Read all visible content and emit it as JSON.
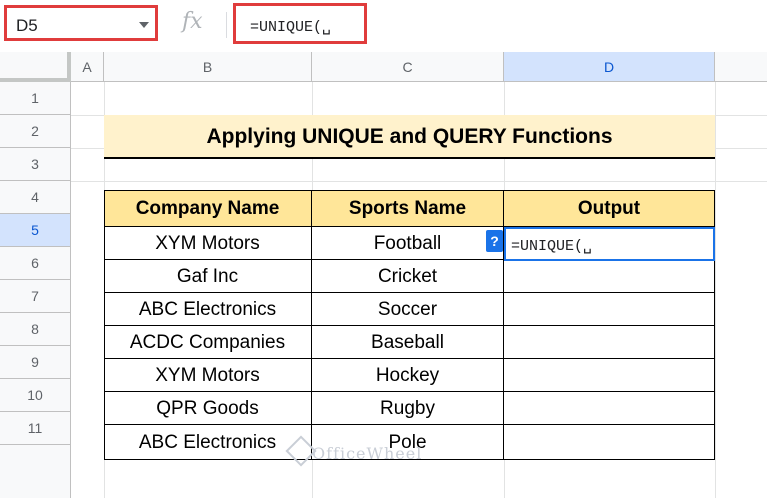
{
  "formula_bar": {
    "name_box": "D5",
    "fx": "fx",
    "formula": "=UNIQUE(␣"
  },
  "columns": [
    "A",
    "B",
    "C",
    "D"
  ],
  "rows": [
    "1",
    "2",
    "3",
    "4",
    "5",
    "6",
    "7",
    "8",
    "9",
    "10",
    "11"
  ],
  "active": {
    "column": "D",
    "row": "5"
  },
  "title": "Applying UNIQUE and QUERY Functions",
  "table": {
    "headers": [
      "Company Name",
      "Sports Name",
      "Output"
    ],
    "rows": [
      [
        "XYM Motors",
        "Football"
      ],
      [
        "Gaf Inc",
        "Cricket"
      ],
      [
        "ABC Electronics",
        "Soccer"
      ],
      [
        "ACDC Companies",
        "Baseball"
      ],
      [
        "XYM Motors",
        "Hockey"
      ],
      [
        "QPR Goods",
        "Rugby"
      ],
      [
        "ABC Electronics",
        "Pole"
      ]
    ]
  },
  "active_cell_text": "=UNIQUE(␣",
  "help_badge": "?",
  "watermark": "OfficeWheel",
  "colors": {
    "title_bg": "#fff2cc",
    "header_bg": "#ffe699",
    "highlight_red": "#e03c3c",
    "active_blue": "#1a73e8"
  }
}
